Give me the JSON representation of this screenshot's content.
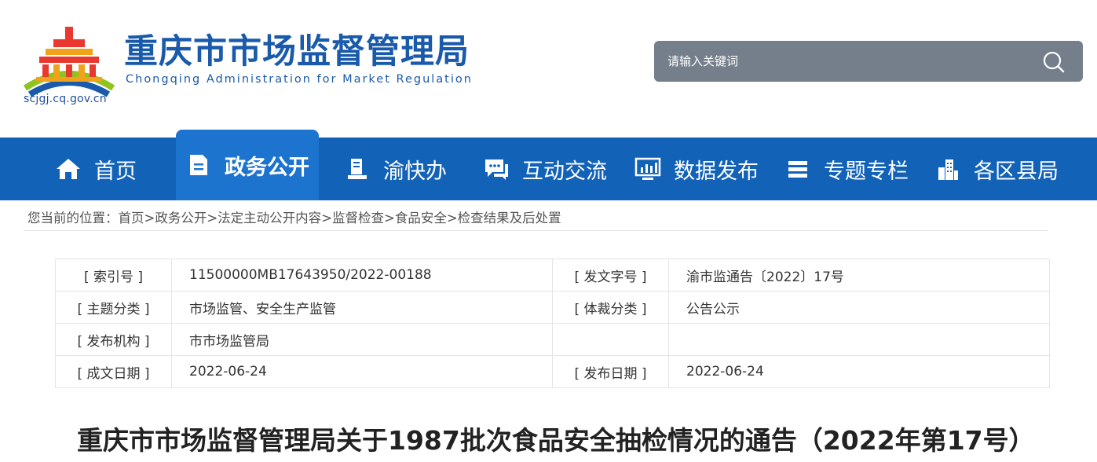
{
  "header": {
    "title_cn": "重庆市市场监督管理局",
    "title_en": "Chongqing  Administration for Market Regulation",
    "domain": "scjgj.cq.gov.cn",
    "search_placeholder": "请输入关键词",
    "search_icon": "search-icon"
  },
  "colors": {
    "nav_bg": "#1262b8",
    "nav_active_bg": "#1c74cf",
    "brand_blue": "#1a5aab",
    "search_bg": "#757f8c"
  },
  "nav": {
    "items": [
      {
        "label": "首页",
        "icon": "home-icon"
      },
      {
        "label": "政务公开",
        "icon": "document-icon",
        "active": true
      },
      {
        "label": "渝快办",
        "icon": "desk-icon"
      },
      {
        "label": "互动交流",
        "icon": "chat-icon"
      },
      {
        "label": "数据发布",
        "icon": "monitor-chart-icon"
      },
      {
        "label": "专题专栏",
        "icon": "list-stack-icon"
      },
      {
        "label": "各区县局",
        "icon": "buildings-icon"
      }
    ]
  },
  "breadcrumb": {
    "prefix": "您当前的位置：",
    "items": [
      "首页",
      "政务公开",
      "法定主动公开内容",
      "监督检查",
      "食品安全",
      "检查结果及后处置"
    ],
    "separator": ">"
  },
  "info": {
    "index_label": "[ 索引号 ]",
    "index_value": "11500000MB17643950/2022-00188",
    "docno_label": "[ 发文字号 ]",
    "docno_value": "渝市监通告〔2022〕17号",
    "topic_label": "[ 主题分类 ]",
    "topic_value": "市场监管、安全生产监管",
    "genre_label": "[ 体裁分类 ]",
    "genre_value": "公告公示",
    "publisher_label": "[ 发布机构 ]",
    "publisher_value": "市市场监管局",
    "created_label": "[ 成文日期 ]",
    "created_value": "2022-06-24",
    "published_label": "[ 发布日期 ]",
    "published_value": "2022-06-24"
  },
  "article": {
    "title": "重庆市市场监督管理局关于1987批次食品安全抽检情况的通告（2022年第17号）"
  }
}
